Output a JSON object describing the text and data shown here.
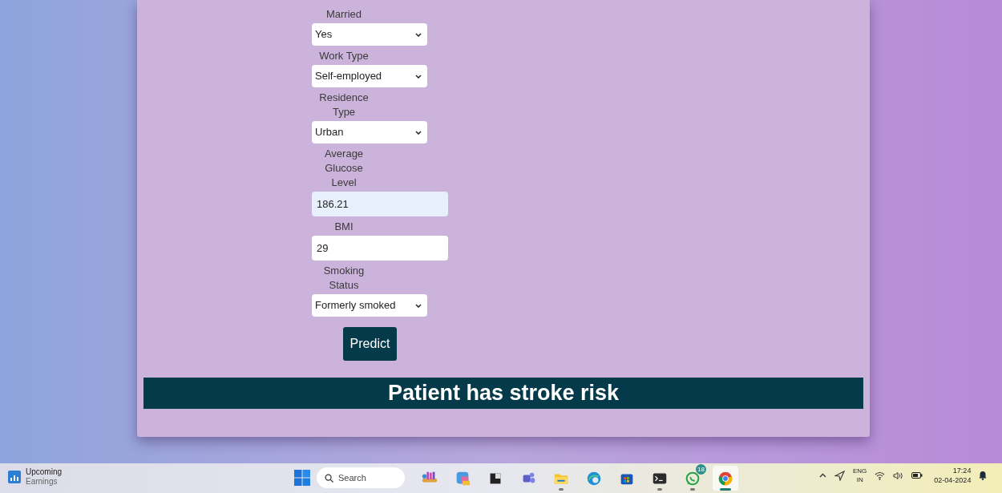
{
  "form": {
    "fields": [
      {
        "kind": "select",
        "label": "Married",
        "value": "Yes"
      },
      {
        "kind": "select",
        "label": "Work Type",
        "value": "Self-employed"
      },
      {
        "kind": "select",
        "label": "Residence Type",
        "value": "Urban"
      },
      {
        "kind": "input",
        "label": "Average Glucose Level",
        "value": "186.21",
        "autofilled": true
      },
      {
        "kind": "input",
        "label": "BMI",
        "value": "29",
        "autofilled": false
      },
      {
        "kind": "select",
        "label": "Smoking Status",
        "value": "Formerly smoked"
      }
    ],
    "submit": "Predict"
  },
  "result": "Patient has stroke risk",
  "taskbar": {
    "widget": {
      "title": "Upcoming",
      "subtitle": "Earnings"
    },
    "search": {
      "placeholder": "Search"
    },
    "apps": [
      {
        "kind": "books",
        "running": false,
        "active": false
      },
      {
        "kind": "editor",
        "running": false,
        "active": false
      },
      {
        "kind": "square",
        "running": false,
        "active": false
      },
      {
        "kind": "teams",
        "running": false,
        "active": false
      },
      {
        "kind": "folder",
        "running": true,
        "active": false
      },
      {
        "kind": "edge",
        "running": false,
        "active": false
      },
      {
        "kind": "store",
        "running": false,
        "active": false
      },
      {
        "kind": "terminal",
        "running": true,
        "active": false
      },
      {
        "kind": "chat",
        "running": true,
        "active": false,
        "badge": "18"
      },
      {
        "kind": "chrome",
        "running": true,
        "active": true
      }
    ],
    "tray": {
      "language": "ENG",
      "region": "IN",
      "time": "17:24",
      "date": "02-04-2024"
    }
  }
}
